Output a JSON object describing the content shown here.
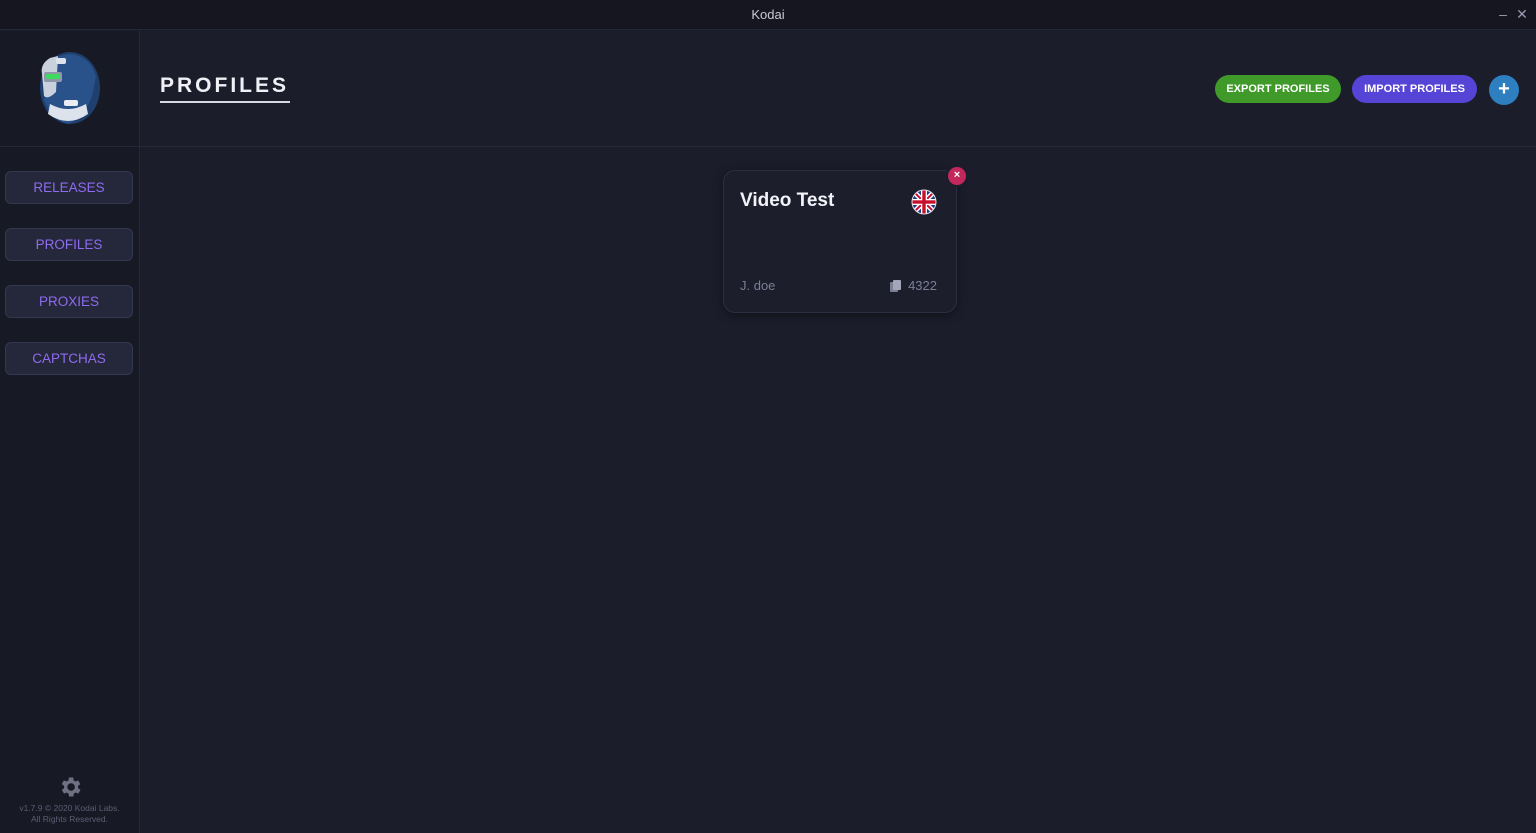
{
  "window": {
    "title": "Kodai",
    "minimize_icon": "minimize-icon",
    "close_icon": "close-icon",
    "minimize_glyph": "–",
    "close_glyph": "✕"
  },
  "sidebar": {
    "logo": "kodai-robot-logo",
    "items": [
      {
        "label": "RELEASES"
      },
      {
        "label": "PROFILES"
      },
      {
        "label": "PROXIES"
      },
      {
        "label": "CAPTCHAS"
      }
    ],
    "settings_icon": "gear-icon",
    "footer_line1": "v1.7.9 © 2020 Kodai Labs.",
    "footer_line2": "All Rights Reserved."
  },
  "header": {
    "title": "PROFILES",
    "export_label": "EXPORT PROFILES",
    "import_label": "IMPORT PROFILES",
    "add_glyph": "+"
  },
  "profiles": [
    {
      "name": "Video Test",
      "flag": "uk-flag-icon",
      "holder": "J. doe",
      "card_last4": "4322",
      "delete_glyph": "×"
    }
  ],
  "colors": {
    "background": "#1b1d2b",
    "sidebar": "#171925",
    "nav_text": "#8f6bf0",
    "export": "#3f9a2a",
    "import": "#5644d6",
    "add": "#2e7fc0",
    "delete": "#c2285c"
  }
}
